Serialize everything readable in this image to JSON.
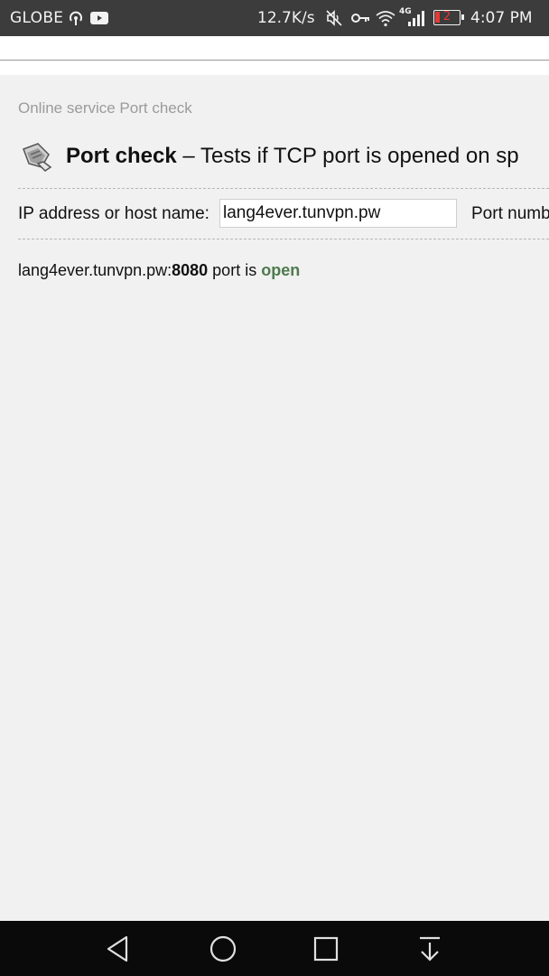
{
  "status_bar": {
    "carrier": "GLOBE",
    "network_speed": "12.7K/s",
    "network_type": "4G",
    "battery_level": "2",
    "time": "4:07 PM",
    "icons": [
      "hotspot-icon",
      "youtube-icon",
      "mute-icon",
      "vpn-key-icon",
      "wifi-icon",
      "signal-icon",
      "battery-icon"
    ]
  },
  "page": {
    "breadcrumb": "Online service Port check",
    "title_bold": "Port check",
    "title_rest": " – Tests if TCP port is opened on sp",
    "form": {
      "host_label": "IP address or host name:",
      "host_value": "lang4ever.tunvpn.pw",
      "port_label": "Port numb"
    },
    "result": {
      "host": "lang4ever.tunvpn.pw:",
      "port": "8080",
      "middle": " port is ",
      "status": "open"
    }
  },
  "nav_bar": {
    "buttons": [
      "back-icon",
      "home-icon",
      "recents-icon",
      "notification-pull-icon"
    ]
  },
  "colors": {
    "status_bar_bg": "#3c3c3c",
    "page_bg": "#f1f1f1",
    "open_status": "#4e7a4e",
    "battery_low": "#e53935"
  }
}
